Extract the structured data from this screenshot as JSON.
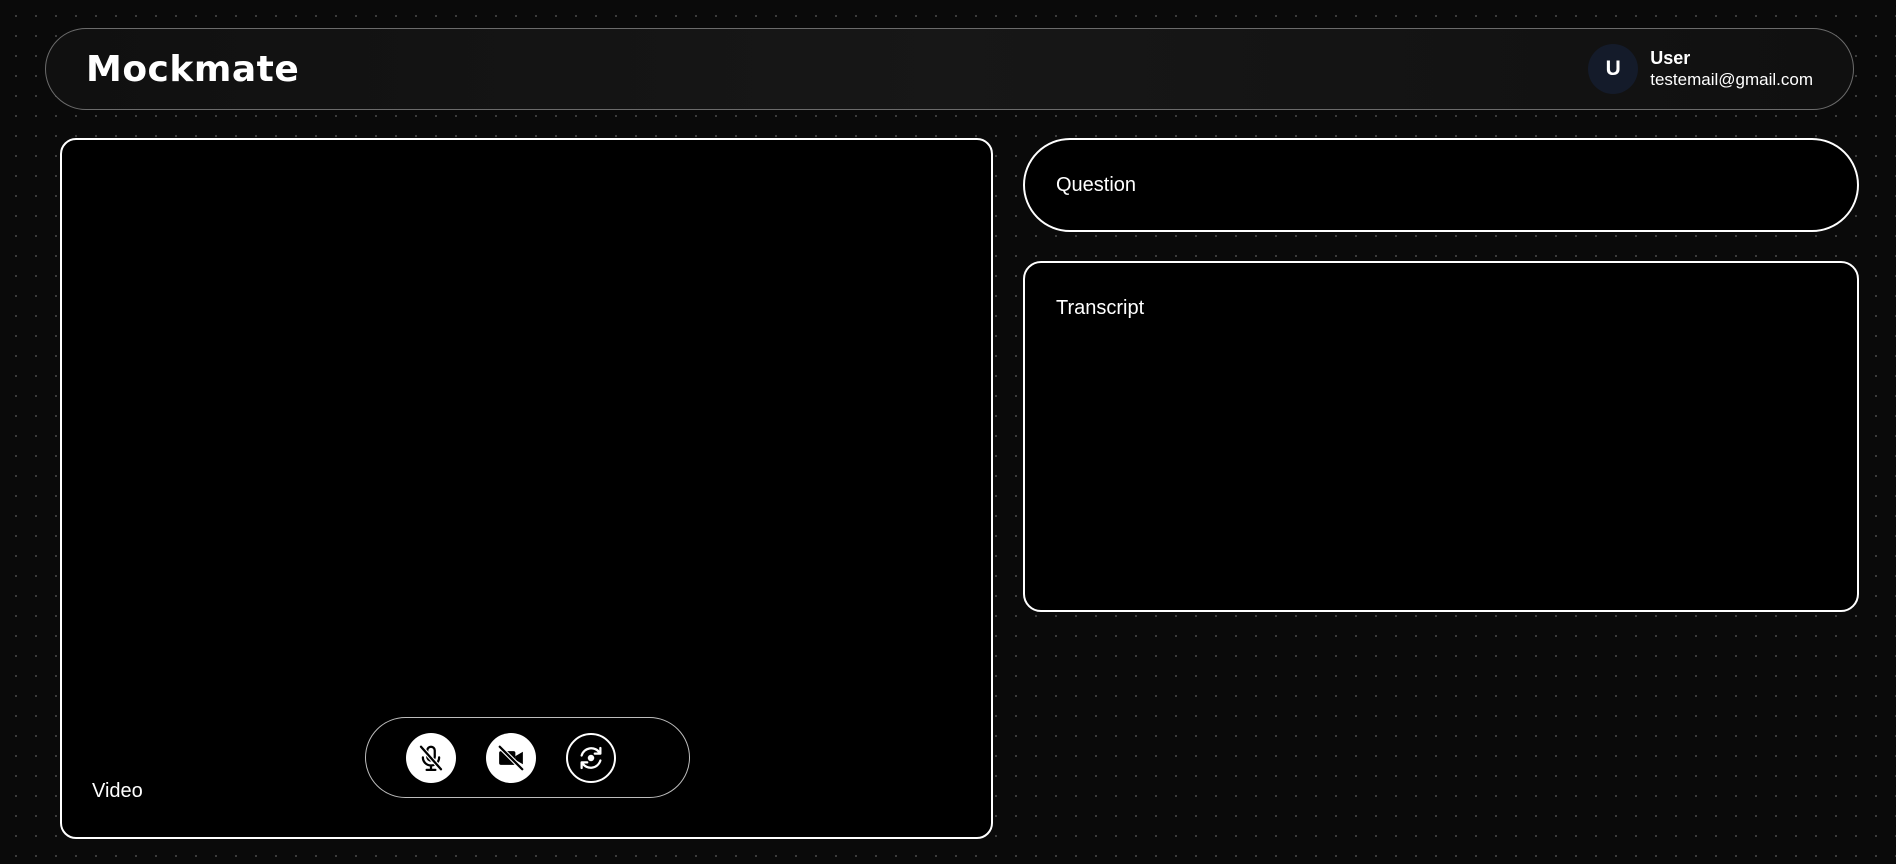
{
  "header": {
    "brand": "Mockmate",
    "user": {
      "initial": "U",
      "name": "User",
      "email": "testemail@gmail.com"
    }
  },
  "video": {
    "label": "Video",
    "controls": [
      {
        "name": "mic-muted",
        "icon": "mic-off-icon",
        "state": "off"
      },
      {
        "name": "camera-off",
        "icon": "video-off-icon",
        "state": "off"
      },
      {
        "name": "switch-camera",
        "icon": "camera-switch-icon",
        "state": "on"
      }
    ]
  },
  "question": {
    "label": "Question"
  },
  "transcript": {
    "label": "Transcript"
  },
  "colors": {
    "background": "#0a0a0a",
    "panel": "#000000",
    "border": "#ffffff",
    "avatar": "#141b2a"
  }
}
